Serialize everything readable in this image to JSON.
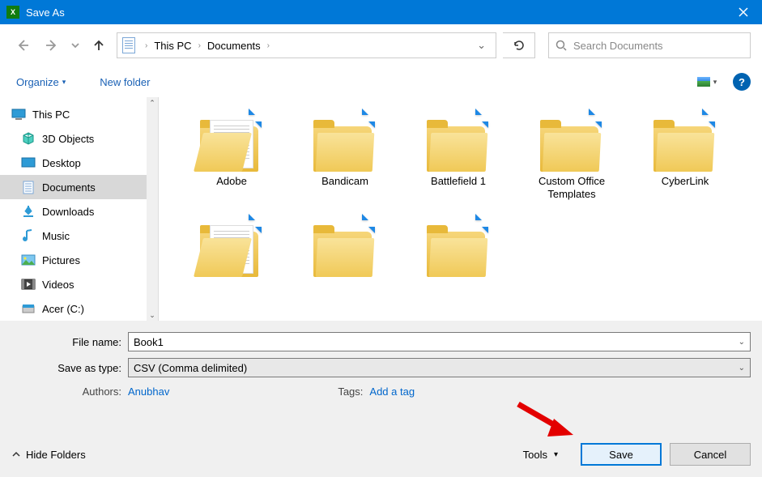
{
  "titlebar": {
    "title": "Save As"
  },
  "nav": {
    "breadcrumb": [
      "This PC",
      "Documents"
    ],
    "search_placeholder": "Search Documents"
  },
  "toolbar": {
    "organize": "Organize",
    "newfolder": "New folder"
  },
  "tree": {
    "root": "This PC",
    "items": [
      "3D Objects",
      "Desktop",
      "Documents",
      "Downloads",
      "Music",
      "Pictures",
      "Videos",
      "Acer (C:)"
    ],
    "selected_index": 2
  },
  "files": {
    "row1": [
      "Adobe",
      "Bandicam",
      "Battlefield 1",
      "Custom Office Templates",
      "CyberLink"
    ],
    "row2": [
      "",
      "",
      ""
    ]
  },
  "form": {
    "filename_label": "File name:",
    "filename_value": "Book1",
    "type_label": "Save as type:",
    "type_value": "CSV (Comma delimited)",
    "authors_label": "Authors:",
    "authors_value": "Anubhav",
    "tags_label": "Tags:",
    "tags_value": "Add a tag"
  },
  "actions": {
    "hide_folders": "Hide Folders",
    "tools": "Tools",
    "save": "Save",
    "cancel": "Cancel"
  }
}
